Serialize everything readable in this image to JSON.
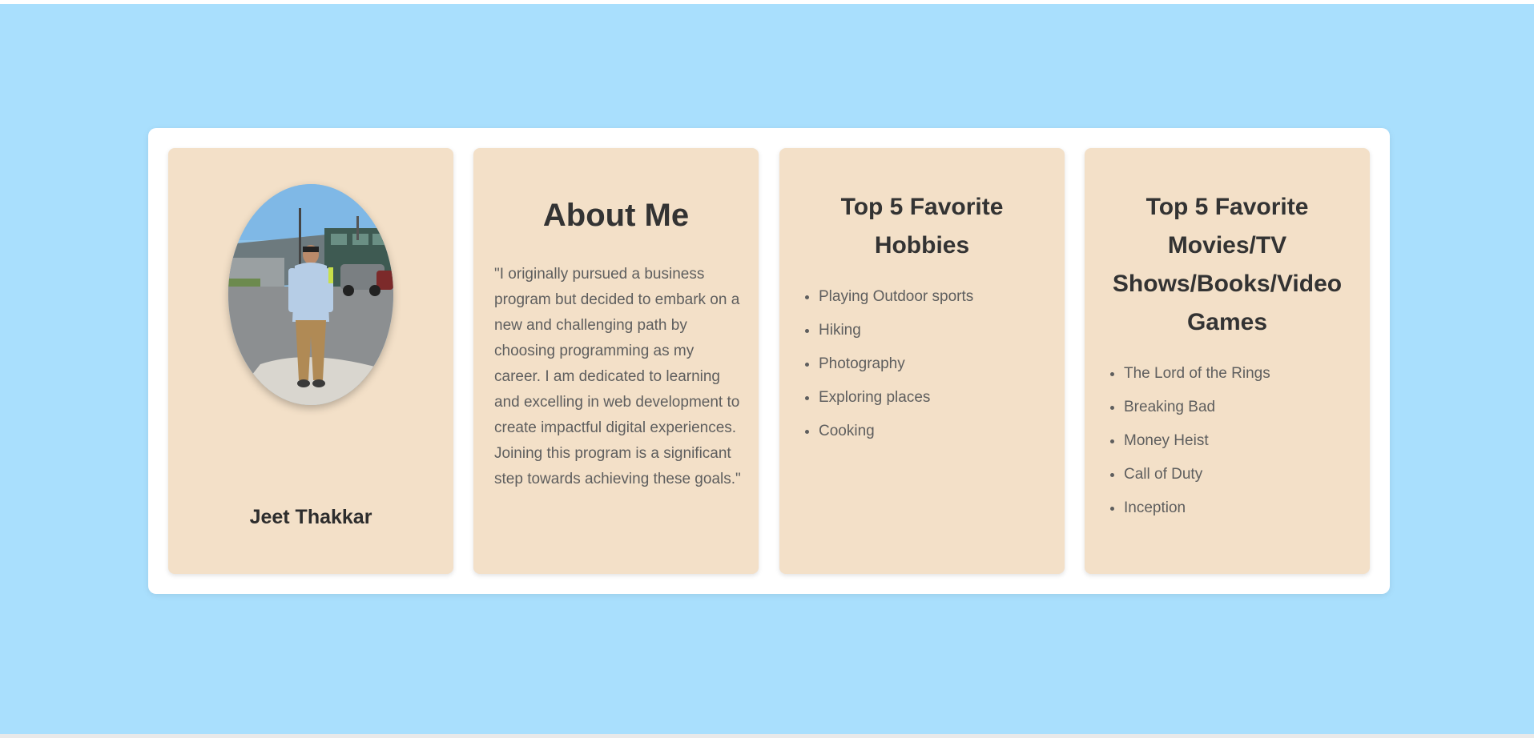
{
  "profile": {
    "name": "Jeet Thakkar",
    "photo_icon": "profile-photo"
  },
  "about": {
    "title": "About Me",
    "text": "\"I originally pursued a business program but decided to embark on a new and challenging path by choosing programming as my career. I am dedicated to learning and excelling in web development to create impactful digital experiences. Joining this program is a significant step towards achieving these goals.\""
  },
  "hobbies": {
    "title": "Top 5 Favorite Hobbies",
    "items": [
      "Playing Outdoor sports",
      "Hiking",
      "Photography",
      "Exploring places",
      "Cooking"
    ]
  },
  "favorites": {
    "title": "Top 5 Favorite Movies/TV Shows/Books/Video Games",
    "items": [
      "The Lord of the Rings",
      "Breaking Bad",
      "Money Heist",
      "Call of Duty",
      "Inception"
    ]
  },
  "colors": {
    "background": "#a9dffd",
    "container": "#ffffff",
    "card": "#f3e0c8",
    "heading": "#333333",
    "body_text": "#5e5e5e"
  }
}
